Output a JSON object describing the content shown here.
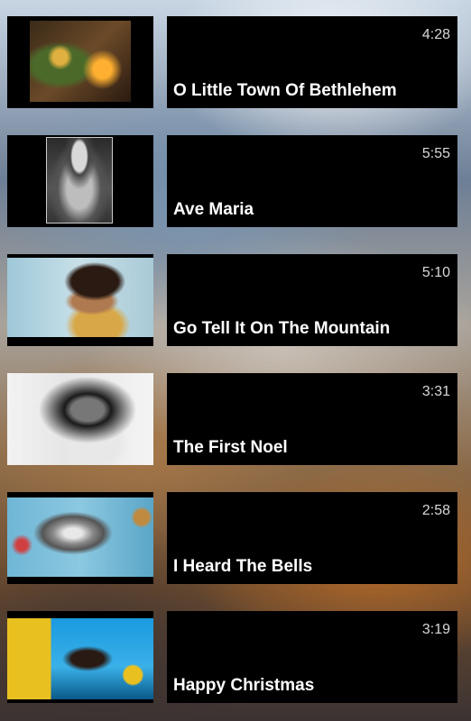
{
  "playlist": [
    {
      "title": "O Little Town Of Bethlehem",
      "duration": "4:28",
      "thumbnail": "christmas-tree-fireplace"
    },
    {
      "title": "Ave Maria",
      "duration": "5:55",
      "thumbnail": "madonna-and-child-statue"
    },
    {
      "title": "Go Tell It On The Mountain",
      "duration": "5:10",
      "thumbnail": "singer-portrait-gold"
    },
    {
      "title": "The First Noel",
      "duration": "3:31",
      "thumbnail": "singer-portrait-bw"
    },
    {
      "title": "I Heard The Bells",
      "duration": "2:58",
      "thumbnail": "silver-bells"
    },
    {
      "title": "Happy Christmas",
      "duration": "3:19",
      "thumbnail": "singer-gift-boxes"
    }
  ]
}
